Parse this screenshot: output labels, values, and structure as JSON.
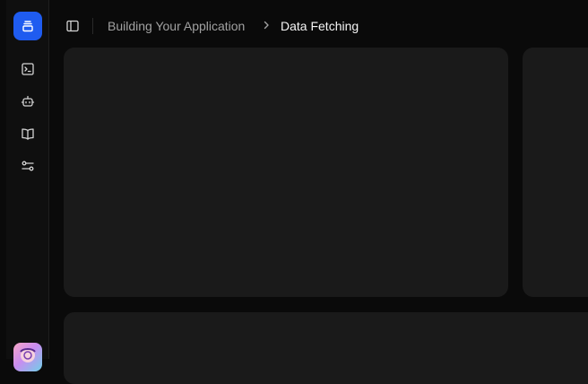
{
  "sidebar": {
    "items": [
      {
        "icon": "terminal-icon"
      },
      {
        "icon": "bot-icon"
      },
      {
        "icon": "book-open-icon"
      },
      {
        "icon": "settings-sliders-icon"
      }
    ]
  },
  "header": {
    "breadcrumb": {
      "parent": "Building Your Application",
      "current": "Data Fetching"
    }
  },
  "colors": {
    "accent": "#1f5cf0",
    "background": "#0a0a0a",
    "card": "#1a1a1a"
  }
}
